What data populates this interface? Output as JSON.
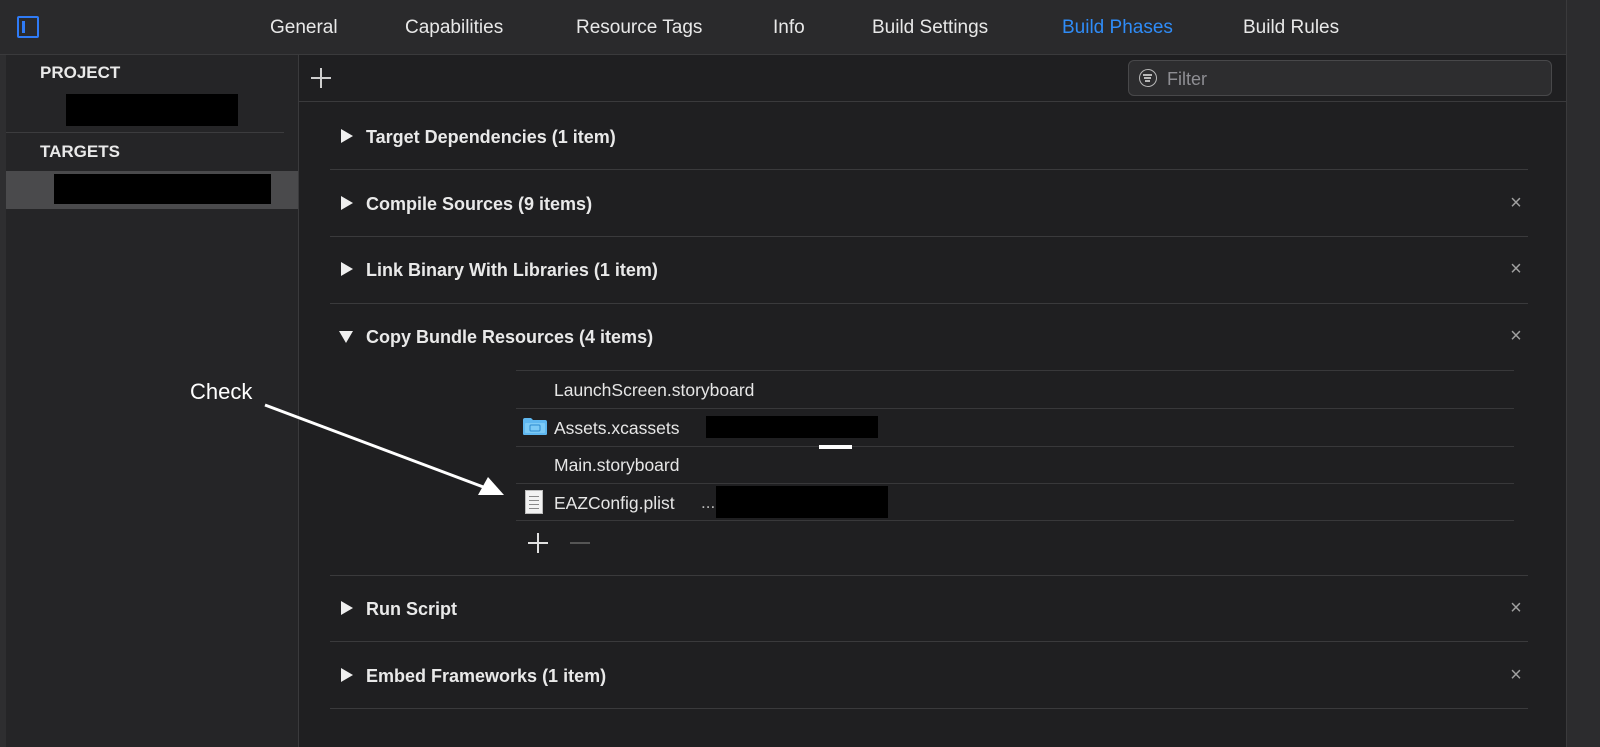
{
  "tabs": [
    {
      "label": "General"
    },
    {
      "label": "Capabilities"
    },
    {
      "label": "Resource Tags"
    },
    {
      "label": "Info"
    },
    {
      "label": "Build Settings"
    },
    {
      "label": "Build Phases",
      "active": true
    },
    {
      "label": "Build Rules"
    }
  ],
  "sidebar": {
    "project_header": "PROJECT",
    "targets_header": "TARGETS"
  },
  "toolbar": {
    "filter_placeholder": "Filter"
  },
  "phases": [
    {
      "title": "Target Dependencies (1 item)",
      "expanded": false,
      "removable": false
    },
    {
      "title": "Compile Sources (9 items)",
      "expanded": false,
      "removable": true
    },
    {
      "title": "Link Binary With Libraries (1 item)",
      "expanded": false,
      "removable": true
    },
    {
      "title": "Copy Bundle Resources (4 items)",
      "expanded": true,
      "removable": true,
      "files": [
        {
          "name": "LaunchScreen.storyboard",
          "icon": "storyboard-icon"
        },
        {
          "name": "Assets.xcassets",
          "icon": "folder-icon"
        },
        {
          "name": "Main.storyboard",
          "icon": "storyboard-icon"
        },
        {
          "name": "EAZConfig.plist",
          "icon": "plist-file-icon",
          "suffix": "..."
        }
      ]
    },
    {
      "title": "Run Script",
      "expanded": false,
      "removable": true
    },
    {
      "title": "Embed Frameworks (1 item)",
      "expanded": false,
      "removable": true
    }
  ],
  "annotation": {
    "label": "Check",
    "target": "EAZConfig.plist"
  },
  "colors": {
    "accent": "#2f8cf7",
    "background": "#1f1f21",
    "sidebar": "#252527",
    "selected_row": "#4a4a4c"
  }
}
